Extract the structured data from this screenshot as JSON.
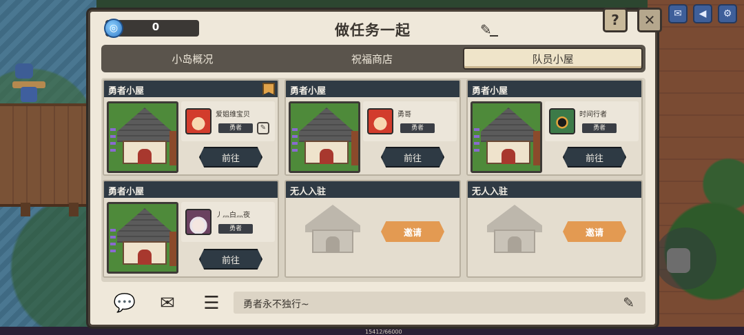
{
  "hud": {
    "exp_text": "15412/66000"
  },
  "dialog": {
    "currency_value": "0",
    "title": "做任务一起",
    "help_label": "?",
    "close_label": "✕"
  },
  "tabs": [
    {
      "label": "小岛概况",
      "active": false
    },
    {
      "label": "祝福商店",
      "active": false
    },
    {
      "label": "队员小屋",
      "active": true
    }
  ],
  "cabins": [
    {
      "title": "勇者小屋",
      "occupied": true,
      "player": "爱姐维宝贝",
      "role": "勇者",
      "action": "前往",
      "avatar": "red-helmet-avatar",
      "has_flag": true,
      "has_edit": true
    },
    {
      "title": "勇者小屋",
      "occupied": true,
      "player": "勇哥",
      "role": "勇者",
      "action": "前往",
      "avatar": "red-helmet-avatar"
    },
    {
      "title": "勇者小屋",
      "occupied": true,
      "player": "时间行者",
      "role": "勇者",
      "action": "前往",
      "avatar": "green-helmet-avatar"
    },
    {
      "title": "勇者小屋",
      "occupied": true,
      "player": "丿灬白灬夜",
      "role": "勇者",
      "action": "前往",
      "avatar": "white-hair-avatar"
    },
    {
      "title": "无人入驻",
      "occupied": false,
      "action": "邀请"
    },
    {
      "title": "无人入驻",
      "occupied": false,
      "action": "邀请"
    }
  ],
  "bottom": {
    "motto": "勇者永不独行~"
  },
  "colors": {
    "accent_invite": "#e39a52",
    "header_dark": "#2f3a44",
    "panel_bg": "#efe8da"
  }
}
